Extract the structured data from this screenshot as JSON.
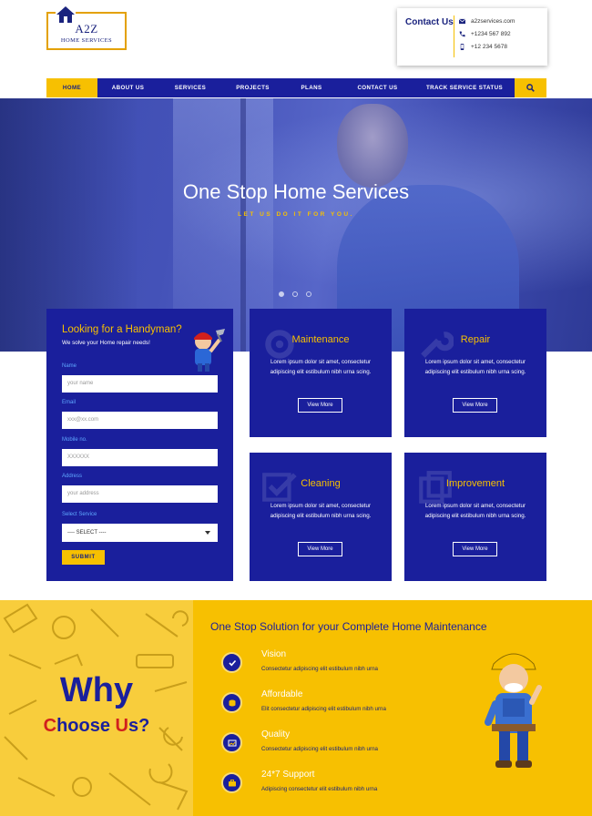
{
  "logo": {
    "title": "A2Z",
    "subtitle": "HOME SERVICES"
  },
  "contact": {
    "title": "Contact Us",
    "email": "a2zservices.com",
    "phone": "+1234 567 892",
    "mobile": "+12 234 5678"
  },
  "nav": {
    "items": [
      {
        "label": "HOME",
        "active": true
      },
      {
        "label": "ABOUT US",
        "active": false
      },
      {
        "label": "SERVICES",
        "active": false
      },
      {
        "label": "PROJECTS",
        "active": false
      },
      {
        "label": "PLANS",
        "active": false
      },
      {
        "label": "CONTACT US",
        "active": false
      },
      {
        "label": "TRACK SERVICE STATUS",
        "active": false
      }
    ],
    "search_icon": "search-icon"
  },
  "hero": {
    "title": "One Stop Home Services",
    "subtitle": "LET US DO IT FOR YOU.",
    "slides": 3,
    "active_slide": 1
  },
  "form": {
    "title": "Looking for a Handyman?",
    "subtitle": "We solve your Home repair needs!",
    "name_label": "Name",
    "name_placeholder": "your name",
    "email_label": "Email",
    "email_placeholder": "xxx@xx.com",
    "mobile_label": "Mobile no.",
    "mobile_placeholder": "XXXXXX",
    "address_label": "Address",
    "address_placeholder": "your address",
    "service_label": "Select Service",
    "service_value": "---- SELECT ----",
    "submit_label": "SUBMIT"
  },
  "services": [
    {
      "title": "Maintenance",
      "text": "Lorem ipsum dolor sit amet, consectetur adipiscing elit estibulum nibh urna scing.",
      "button": "View More"
    },
    {
      "title": "Repair",
      "text": "Lorem ipsum dolor sit amet, consectetur adipiscing elit estibulum nibh urna scing.",
      "button": "View More"
    },
    {
      "title": "Cleaning",
      "text": "Lorem ipsum dolor sit amet, consectetur adipiscing elit estibulum nibh urna scing.",
      "button": "View More"
    },
    {
      "title": "Improvement",
      "text": "Lorem ipsum dolor sit amet, consectetur adipiscing elit estibulum nibh urna scing.",
      "button": "View More"
    }
  ],
  "why": {
    "big": "Why",
    "small_pre": "",
    "small_c": "C",
    "small_mid": "hoose ",
    "small_u": "U",
    "small_post": "s?"
  },
  "solution": {
    "title": "One Stop Solution for your Complete Home Maintenance",
    "features": [
      {
        "title": "Vision",
        "text": "Consectetur adipiscing elit estibulum nibh urna",
        "icon": "check-icon"
      },
      {
        "title": "Affordable",
        "text": "Elit consectetur adipiscing elit estibulum nibh urna",
        "icon": "coins-icon"
      },
      {
        "title": "Quality",
        "text": "Consectetur adipiscing elit estibulum nibh urna",
        "icon": "picture-icon"
      },
      {
        "title": "24*7 Support",
        "text": "Adipiscing consectetur elit estibulum nibh urna",
        "icon": "briefcase-icon"
      }
    ]
  },
  "colors": {
    "navy": "#1a1f9c",
    "yellow": "#f7c001",
    "red": "#d1201d"
  }
}
